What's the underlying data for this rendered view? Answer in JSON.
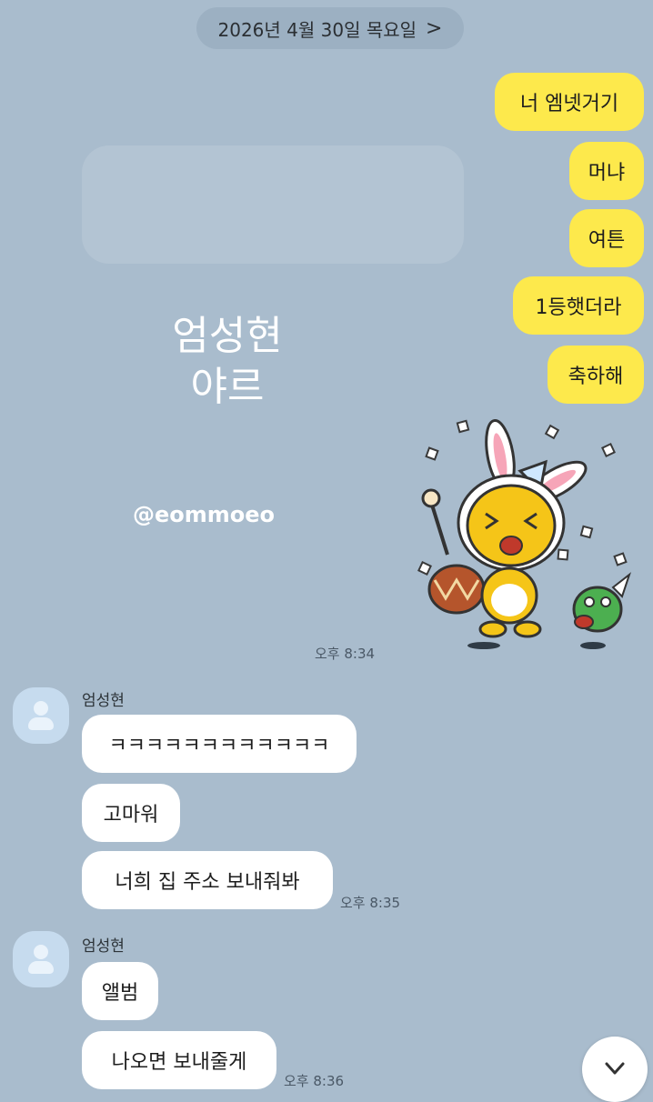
{
  "header": {
    "date": "2026년 4월 30일 목요일",
    "chevron": ">"
  },
  "outgoing": [
    {
      "text": "너 엠넷거기"
    },
    {
      "text": "머냐"
    },
    {
      "text": "여튼"
    },
    {
      "text": "1등햇더라"
    },
    {
      "text": "축하해"
    }
  ],
  "sticker": {
    "icon": "bunny-drummer-sticker-icon",
    "time": "오후 8:34"
  },
  "overlay": {
    "line1": "엄성현",
    "line2": "야르",
    "watermark": "@eommoeo"
  },
  "groups": [
    {
      "sender": "엄성현",
      "messages": [
        {
          "text": "ㅋㅋㅋㅋㅋㅋㅋㅋㅋㅋㅋㅋ"
        },
        {
          "text": "고마워"
        },
        {
          "text": "너희 집 주소 보내줘봐"
        }
      ],
      "time": "오후 8:35"
    },
    {
      "sender": "엄성현",
      "messages": [
        {
          "text": "앨범"
        },
        {
          "text": "나오면 보내줄게"
        }
      ],
      "time": "오후 8:36"
    }
  ],
  "scroll_button": {
    "icon": "chevron-down-icon"
  },
  "colors": {
    "background": "#a9bccd",
    "outgoing_bubble": "#fde94c",
    "incoming_bubble": "#ffffff"
  }
}
